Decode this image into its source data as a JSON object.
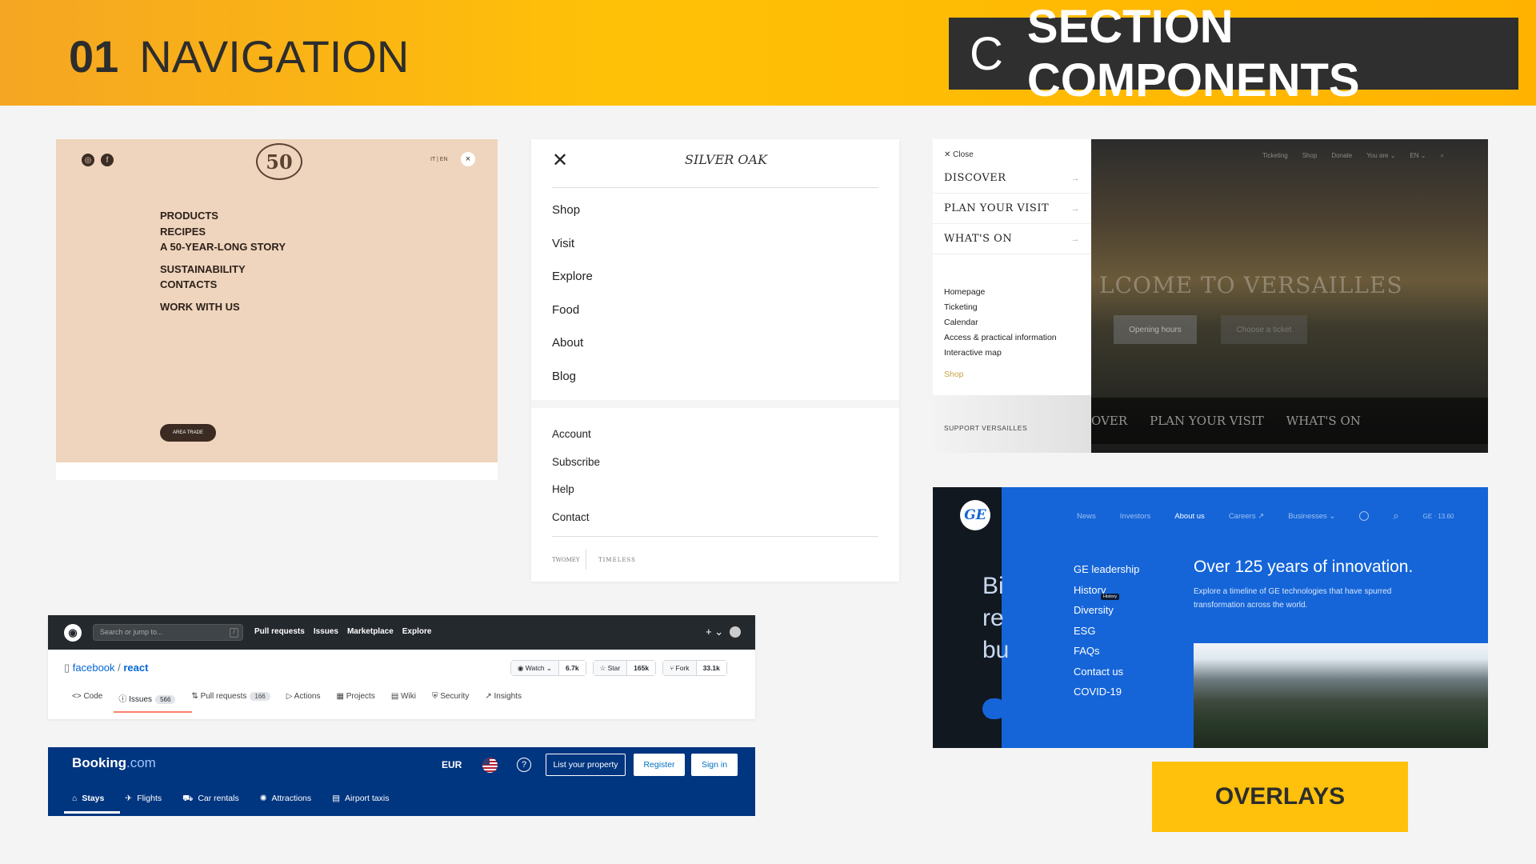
{
  "header": {
    "number": "01",
    "title": "NAVIGATION",
    "badge_letter": "C",
    "badge_title": "SECTION COMPONENTS"
  },
  "panel1": {
    "logo_text": "50",
    "lang": "IT | EN",
    "close": "×",
    "menu": [
      "PRODUCTS",
      "RECIPES",
      "A 50-YEAR-LONG STORY",
      "SUSTAINABILITY",
      "CONTACTS",
      "WORK WITH US"
    ],
    "trade_button": "AREA TRADE",
    "social": [
      "◎",
      "f"
    ]
  },
  "panel2": {
    "close": "✕",
    "brand": "SILVER OAK",
    "primary": [
      "Shop",
      "Visit",
      "Explore",
      "Food",
      "About",
      "Blog"
    ],
    "secondary": [
      "Account",
      "Subscribe",
      "Help",
      "Contact"
    ],
    "footer_left": "TWOMEY",
    "footer_right": "TIMELESS"
  },
  "panel3": {
    "close": "Close",
    "main": [
      "DISCOVER",
      "PLAN YOUR VISIT",
      "WHAT'S ON"
    ],
    "subs": [
      "Homepage",
      "Ticketing",
      "Calendar",
      "Access & practical information",
      "Interactive map"
    ],
    "shop": "Shop",
    "support": "SUPPORT VERSAILLES",
    "topnav": [
      "Ticketing",
      "Shop",
      "Donate",
      "You are ⌄",
      "EN ⌄"
    ],
    "welcome": "LCOME TO VERSAILLES",
    "btn1": "Opening hours",
    "btn2": "Choose a ticket",
    "bar": [
      "OVER",
      "PLAN YOUR VISIT",
      "WHAT'S ON"
    ]
  },
  "panel4": {
    "logo": "GE",
    "bigtext": [
      "Bi",
      "re",
      "bu"
    ],
    "topnav": [
      "News",
      "Investors",
      "About us",
      "Careers ↗",
      "Businesses ⌄"
    ],
    "ticker": "GE · 13.60",
    "links": [
      "GE leadership",
      "History",
      "Diversity",
      "ESG",
      "FAQs",
      "Contact us",
      "COVID-19"
    ],
    "tooltip": "History",
    "headline": "Over 125 years of innovation.",
    "description": "Explore a timeline of GE technologies that have spurred transformation across the world."
  },
  "github": {
    "search_placeholder": "Search or jump to...",
    "slash": "/",
    "nav": [
      "Pull requests",
      "Issues",
      "Marketplace",
      "Explore"
    ],
    "plus": "+ ⌄",
    "owner": "facebook",
    "repo": "react",
    "buttons": [
      {
        "label": "◉ Watch ⌄",
        "count": "6.7k"
      },
      {
        "label": "☆ Star",
        "count": "165k"
      },
      {
        "label": "⑂ Fork",
        "count": "33.1k"
      }
    ],
    "tabs": [
      {
        "label": "<> Code",
        "count": ""
      },
      {
        "label": "ⓘ Issues",
        "count": "566"
      },
      {
        "label": "⇅ Pull requests",
        "count": "166"
      },
      {
        "label": "▷ Actions",
        "count": ""
      },
      {
        "label": "▦ Projects",
        "count": ""
      },
      {
        "label": "▤ Wiki",
        "count": ""
      },
      {
        "label": "⛨ Security",
        "count": ""
      },
      {
        "label": "↗ Insights",
        "count": ""
      }
    ]
  },
  "booking": {
    "logo_main": "Booking",
    "logo_dot": ".com",
    "currency": "EUR",
    "help": "?",
    "list_property": "List your property",
    "register": "Register",
    "sign_in": "Sign in",
    "tabs": [
      {
        "icon": "⌂",
        "label": "Stays"
      },
      {
        "icon": "✈",
        "label": "Flights"
      },
      {
        "icon": "⛟",
        "label": "Car rentals"
      },
      {
        "icon": "✺",
        "label": "Attractions"
      },
      {
        "icon": "▤",
        "label": "Airport taxis"
      }
    ]
  },
  "overlay_label": "OVERLAYS",
  "colors": {
    "header": "#ffc107",
    "badge": "#2f2f2f",
    "ge_blue": "#1565d8",
    "booking_blue": "#003580",
    "github_dark": "#24292e"
  }
}
